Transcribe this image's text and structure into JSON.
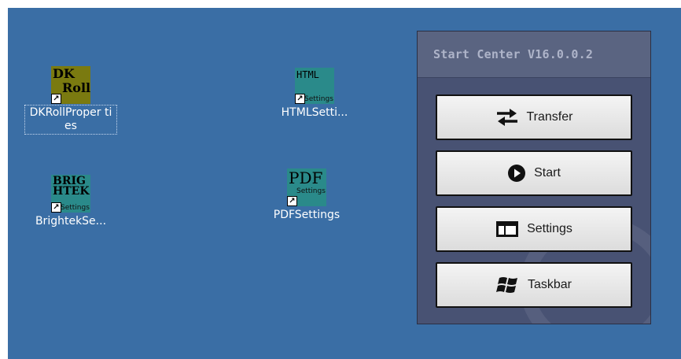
{
  "desktop": {
    "icons": [
      {
        "label": "DKRollProper ties",
        "tile_line1": "DK",
        "tile_line2": "Roll",
        "tile_sub": "",
        "tile_bg": "#7a7a10"
      },
      {
        "label": "HTMLSetti...",
        "tile_line1": "HTML",
        "tile_line2": "",
        "tile_sub": "Settings",
        "tile_bg": "#2a8a8a"
      },
      {
        "label": "BrightekSe...",
        "tile_line1": "BRIG",
        "tile_line2": "HTEK",
        "tile_sub": "Settings",
        "tile_bg": "#2a8a8a"
      },
      {
        "label": "PDFSettings",
        "tile_line1": "PDF",
        "tile_line2": "",
        "tile_sub": "Settings",
        "tile_bg": "#2a8a8a"
      }
    ],
    "background_color": "#3a6ea5"
  },
  "start_center": {
    "title": "Start Center V16.0.0.2",
    "buttons": [
      {
        "label": "Transfer",
        "icon": "transfer-arrows-icon"
      },
      {
        "label": "Start",
        "icon": "play-circle-icon"
      },
      {
        "label": "Settings",
        "icon": "settings-window-icon"
      },
      {
        "label": "Taskbar",
        "icon": "windows-flag-icon"
      }
    ]
  }
}
